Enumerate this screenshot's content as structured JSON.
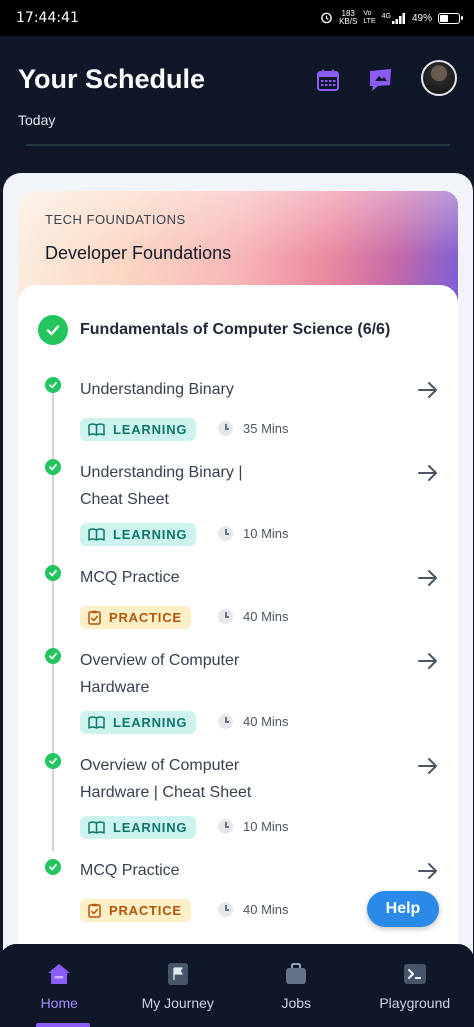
{
  "status_bar": {
    "time": "17:44:41",
    "speed_value": "183",
    "speed_unit": "KB/S",
    "net_top": "Vo",
    "net_bottom": "LTE",
    "signal": "4G",
    "battery": "49%",
    "battery_level": 0.49
  },
  "header": {
    "title": "Your Schedule",
    "subtitle": "Today",
    "calendar_icon": "calendar-icon",
    "chat_icon": "chat-icon",
    "accent_color": "#8b5cf6"
  },
  "course": {
    "track": "TECH FOUNDATIONS",
    "name": "Developer Foundations"
  },
  "module": {
    "title": "Fundamentals of Computer Science (6/6)",
    "status": "completed"
  },
  "items": [
    {
      "title": "Understanding Binary",
      "tag": "LEARNING",
      "duration": "35 Mins"
    },
    {
      "title": "Understanding Binary | Cheat Sheet",
      "tag": "LEARNING",
      "duration": "10 Mins"
    },
    {
      "title": "MCQ Practice",
      "tag": "PRACTICE",
      "duration": "40 Mins"
    },
    {
      "title": "Overview of Computer Hardware",
      "tag": "LEARNING",
      "duration": "40 Mins"
    },
    {
      "title": "Overview of Computer Hardware | Cheat Sheet",
      "tag": "LEARNING",
      "duration": "10 Mins"
    },
    {
      "title": "MCQ Practice",
      "tag": "PRACTICE",
      "duration": "40 Mins"
    }
  ],
  "help_button": "Help",
  "bottom_nav": [
    {
      "label": "Home",
      "icon": "home-icon",
      "active": true
    },
    {
      "label": "My Journey",
      "icon": "flag-icon",
      "active": false
    },
    {
      "label": "Jobs",
      "icon": "briefcase-icon",
      "active": false
    },
    {
      "label": "Playground",
      "icon": "terminal-icon",
      "active": false
    }
  ]
}
